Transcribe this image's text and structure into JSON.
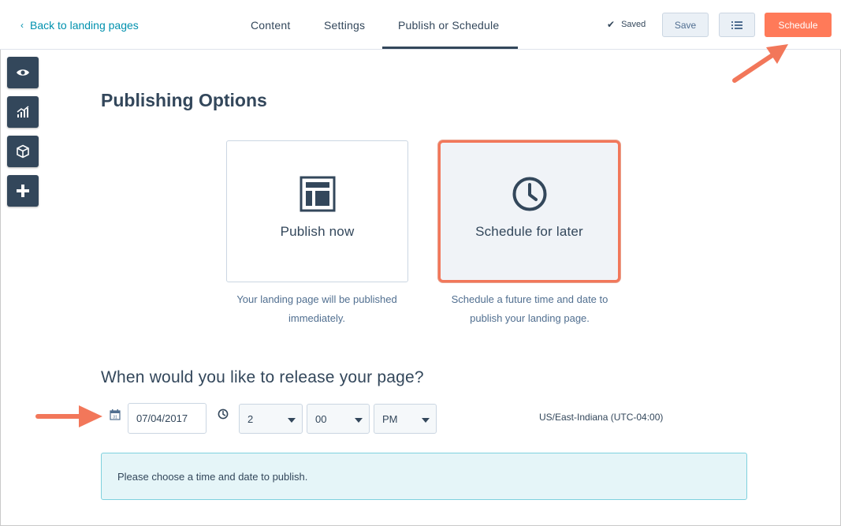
{
  "header": {
    "back_label": "Back to landing pages",
    "tabs": [
      "Content",
      "Settings",
      "Publish or Schedule"
    ],
    "saved_label": "Saved",
    "save_label": "Save",
    "schedule_label": "Schedule"
  },
  "sidebar_tools": [
    "preview-icon",
    "analytics-icon",
    "modules-icon",
    "add-icon"
  ],
  "main": {
    "title": "Publishing Options",
    "options": [
      {
        "label": "Publish now",
        "description": "Your landing page will be published immediately.",
        "icon": "layout-icon",
        "selected": false
      },
      {
        "label": "Schedule for later",
        "description": "Schedule a future time and date to publish your landing page.",
        "icon": "clock-icon",
        "selected": true
      }
    ],
    "release_heading": "When would you like to release your page?",
    "date_value": "07/04/2017",
    "hour_value": "2",
    "minute_value": "00",
    "ampm_value": "PM",
    "timezone": "US/East-Indiana (UTC-04:00)",
    "alert_text": "Please choose a time and date to publish."
  },
  "colors": {
    "accent": "#ff7a59",
    "primary_text": "#33475b",
    "link": "#0091ae",
    "alert_bg": "#e5f5f8",
    "annotation_arrow": "#f2775a"
  }
}
